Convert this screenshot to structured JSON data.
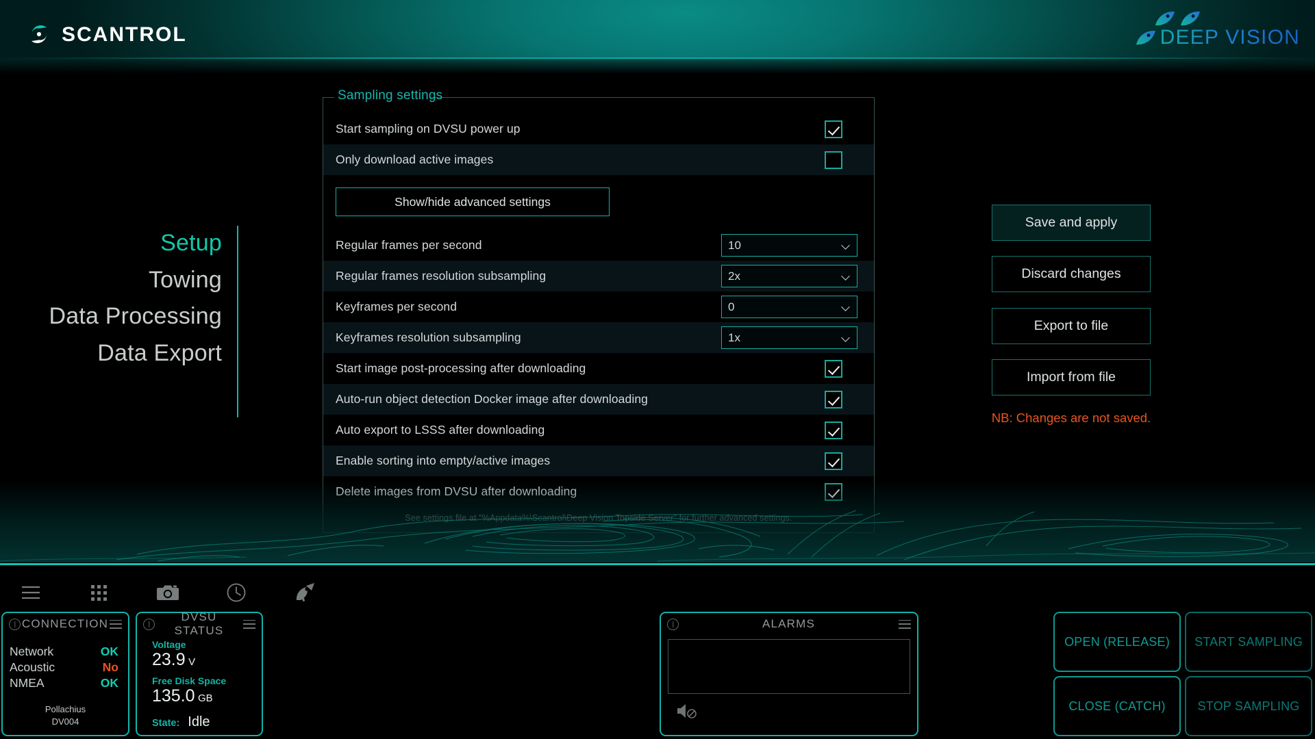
{
  "header": {
    "brand_left": "SCANTROL",
    "brand_right": "DEEP VISION",
    "accent_teal": "#13c8a8",
    "accent_blue": "#1b63c9"
  },
  "nav": {
    "items": [
      {
        "label": "Setup",
        "active": true
      },
      {
        "label": "Towing",
        "active": false
      },
      {
        "label": "Data Processing",
        "active": false
      },
      {
        "label": "Data Export",
        "active": false
      }
    ]
  },
  "settings": {
    "group_title": "Sampling settings",
    "advanced_button": "Show/hide advanced settings",
    "footnote": "See settings file at \"%Appdata%\\Scantrol\\Deep Vision Topside Server\" for further advanced settings.",
    "checkbox_rows_top": [
      {
        "label": "Start sampling on DVSU power up",
        "checked": true
      },
      {
        "label": "Only download active images",
        "checked": false
      }
    ],
    "select_rows": [
      {
        "label": "Regular frames per second",
        "value": "10"
      },
      {
        "label": "Regular frames resolution subsampling",
        "value": "2x"
      },
      {
        "label": "Keyframes per second",
        "value": "0"
      },
      {
        "label": "Keyframes resolution subsampling",
        "value": "1x"
      }
    ],
    "checkbox_rows_bottom": [
      {
        "label": "Start image post-processing after downloading",
        "checked": true
      },
      {
        "label": "Auto-run object detection Docker image after downloading",
        "checked": true
      },
      {
        "label": "Auto export to LSSS after downloading",
        "checked": true
      },
      {
        "label": "Enable sorting into empty/active images",
        "checked": true
      },
      {
        "label": "Delete images from DVSU after downloading",
        "checked": true
      }
    ]
  },
  "side_actions": {
    "save_apply": "Save and apply",
    "discard": "Discard changes",
    "export_file": "Export to file",
    "import_file": "Import from file",
    "notice": "NB: Changes are not saved.",
    "notice_color": "#e8541f"
  },
  "toolbar": {
    "icons": [
      "menu-icon",
      "grid-icon",
      "camera-icon",
      "clock-icon",
      "satellite-dish-icon"
    ]
  },
  "connection_panel": {
    "title": "CONNECTION",
    "rows": [
      {
        "name": "Network",
        "value": "OK",
        "state": "ok"
      },
      {
        "name": "Acoustic",
        "value": "No",
        "state": "no"
      },
      {
        "name": "NMEA",
        "value": "OK",
        "state": "ok"
      }
    ],
    "vessel_name": "Pollachius",
    "vessel_id": "DV004"
  },
  "dvsu_panel": {
    "title": "DVSU STATUS",
    "voltage_label": "Voltage",
    "voltage_value": "23.9",
    "voltage_unit": "V",
    "disk_label": "Free Disk Space",
    "disk_value": "135.0",
    "disk_unit": "GB",
    "state_label": "State:",
    "state_value": "Idle"
  },
  "alarms_panel": {
    "title": "ALARMS",
    "entries": [],
    "mute_icon": "speaker-muted-icon"
  },
  "bottom_actions": [
    {
      "label": "OPEN (RELEASE)",
      "dim": false
    },
    {
      "label": "START SAMPLING",
      "dim": true
    },
    {
      "label": "CLOSE (CATCH)",
      "dim": false
    },
    {
      "label": "STOP SAMPLING",
      "dim": true
    }
  ]
}
